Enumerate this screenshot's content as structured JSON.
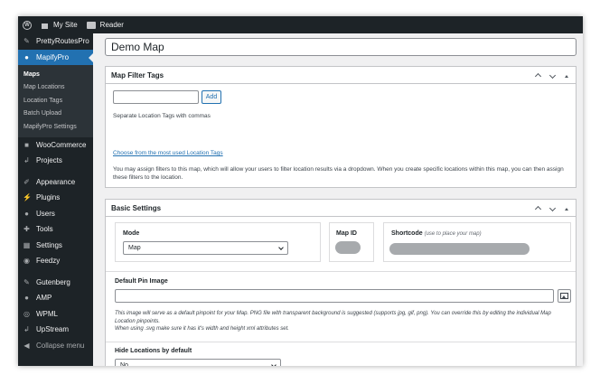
{
  "adminbar": {
    "site_label": "My Site",
    "reader_label": "Reader"
  },
  "sidebar": {
    "top_items": [
      {
        "label": "PrettyRoutesPro",
        "icon": "pin-icon"
      },
      {
        "label": "MapifyPro",
        "icon": "map-marker-icon"
      }
    ],
    "submenu": [
      "Maps",
      "Map Locations",
      "Location Tags",
      "Batch Upload",
      "MapifyPro Settings"
    ],
    "items_group1": [
      {
        "label": "WooCommerce",
        "icon": "woocommerce-icon"
      },
      {
        "label": "Projects",
        "icon": "projects-icon"
      }
    ],
    "items_group2": [
      {
        "label": "Appearance",
        "icon": "brush-icon"
      },
      {
        "label": "Plugins",
        "icon": "plugin-icon"
      },
      {
        "label": "Users",
        "icon": "users-icon"
      },
      {
        "label": "Tools",
        "icon": "wrench-icon"
      },
      {
        "label": "Settings",
        "icon": "settings-icon"
      },
      {
        "label": "Feedzy",
        "icon": "feed-icon"
      }
    ],
    "items_group3": [
      {
        "label": "Gutenberg",
        "icon": "pencil-icon"
      },
      {
        "label": "AMP",
        "icon": "amp-icon"
      },
      {
        "label": "WPML",
        "icon": "wpml-icon"
      },
      {
        "label": "UpStream",
        "icon": "upstream-icon"
      }
    ],
    "collapse_label": "Collapse menu"
  },
  "editor": {
    "title": "Demo Map",
    "filter_tags": {
      "heading": "Map Filter Tags",
      "add_label": "Add",
      "separate_hint": "Separate Location Tags with commas",
      "choose_link": "Choose from the most used Location Tags",
      "description": "You may assign filters to this map, which will allow your users to filter location results via a dropdown. When you create specific locations within this map, you can then assign these filters to the location."
    },
    "basic_settings": {
      "heading": "Basic Settings",
      "mode_label": "Mode",
      "mode_value": "Map",
      "map_id_label": "Map ID",
      "shortcode_label": "Shortcode",
      "shortcode_hint": "(use to place your map)",
      "pin_label": "Default Pin Image",
      "pin_help_1": "This image will serve as a default pinpoint for your Map. PNG file with transparent background is suggested (supports jpg, gif, png). You can override this by editing the individual Map Location pinpoints.",
      "pin_help_2": "When using .svg make sure it has it's width and height xml attributes set.",
      "hide_label": "Hide Locations by default",
      "hide_value": "No"
    }
  },
  "colors": {
    "admin_dark": "#1d2327",
    "accent_blue": "#2271b1"
  }
}
